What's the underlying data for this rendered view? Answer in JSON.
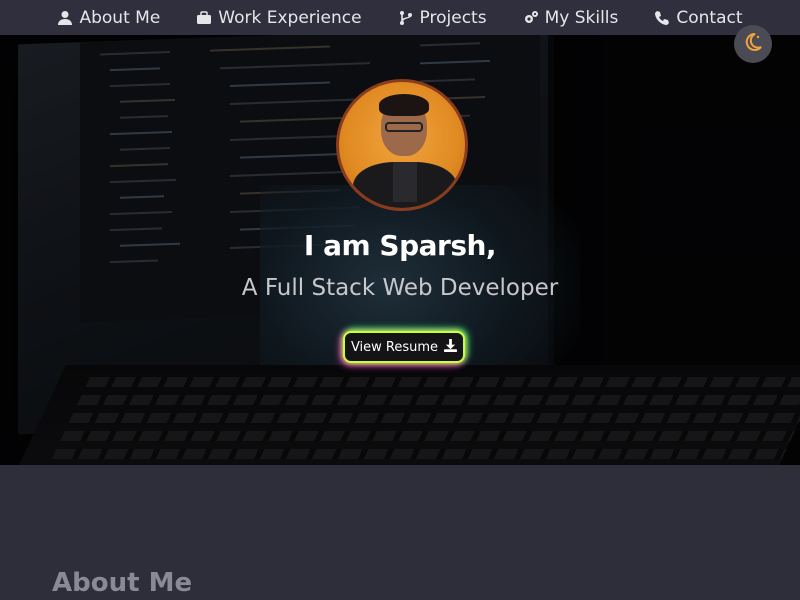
{
  "nav": {
    "items": [
      {
        "label": "About Me",
        "icon": "user-icon"
      },
      {
        "label": "Work Experience",
        "icon": "briefcase-icon"
      },
      {
        "label": "Projects",
        "icon": "code-branch-icon"
      },
      {
        "label": "My Skills",
        "icon": "gears-icon"
      },
      {
        "label": "Contact",
        "icon": "phone-icon"
      }
    ]
  },
  "theme_toggle": {
    "icon": "moon-icon",
    "accent": "#f2a33a"
  },
  "hero": {
    "intro": "I am Sparsh,",
    "role": "A Full Stack Web Developer",
    "resume_button": "View Resume"
  },
  "about": {
    "heading": "About Me"
  },
  "colors": {
    "nav_bg": "#2f2f3d",
    "page_bg": "#2e2e3a",
    "button_glow": "#c9ff3b"
  }
}
